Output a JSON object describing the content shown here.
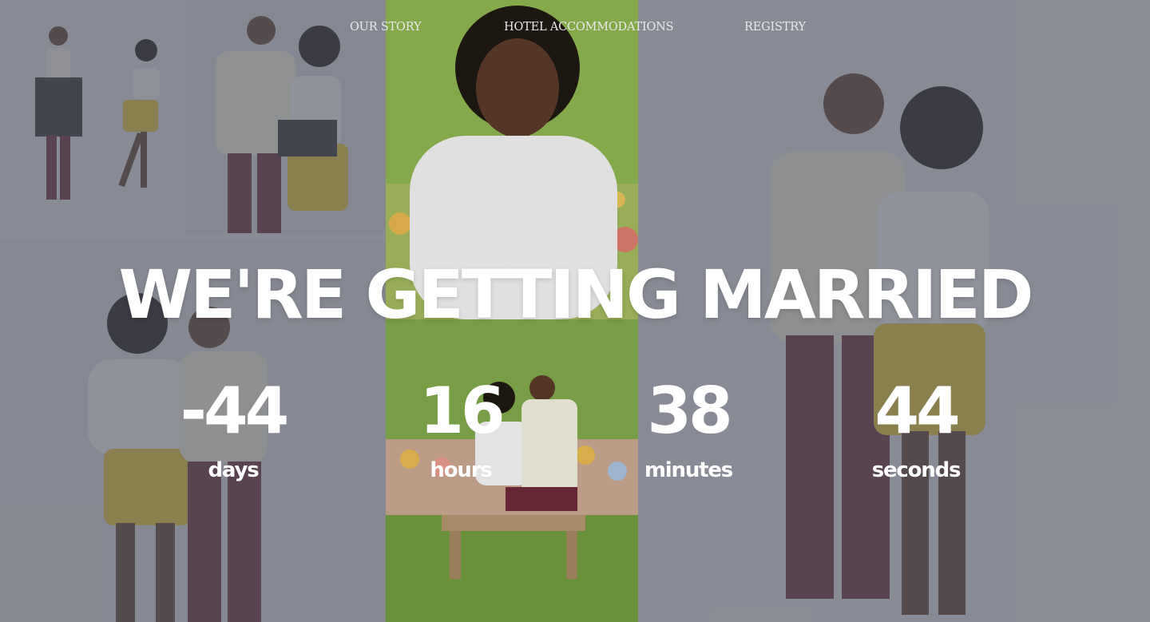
{
  "nav": {
    "items": [
      {
        "label": "OUR STORY"
      },
      {
        "label": "HOTEL ACCOMMODATIONS"
      },
      {
        "label": "REGISTRY"
      }
    ]
  },
  "hero": {
    "headline": "WE'RE GETTING MARRIED"
  },
  "countdown": {
    "days": {
      "value": "-44",
      "label": "days"
    },
    "hours": {
      "value": "16",
      "label": "hours"
    },
    "minutes": {
      "value": "38",
      "label": "minutes"
    },
    "seconds": {
      "value": "44",
      "label": "seconds"
    }
  },
  "colors": {
    "overlay": "#6f737a",
    "text": "#ffffff",
    "nav_text": "#e8e9ec",
    "garden_green": "#7fa845"
  }
}
